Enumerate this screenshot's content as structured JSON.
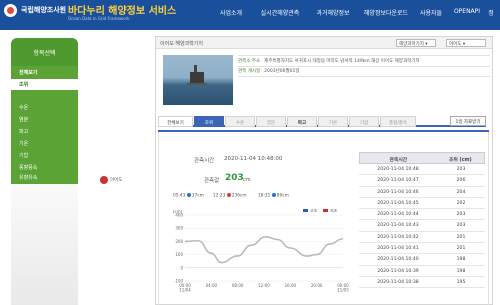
{
  "header": {
    "agency": "국립해양조사원",
    "service": "바다누리 해양정보 서비스",
    "subtitle": "Ocean Data in Grid Framework",
    "nav": [
      "사업소개",
      "실시간해양관측",
      "과거해양정보",
      "해양정보다운로드",
      "사용자들",
      "OPENAPI"
    ],
    "nav_tail": "정"
  },
  "sidebar": {
    "title": "항목선택",
    "items": [
      "전체보기",
      "조위",
      "수온",
      "염분",
      "파고",
      "기온",
      "기압",
      "풍향풍속",
      "유향유속"
    ],
    "active_index": 1,
    "legend_label": "이어도"
  },
  "panel": {
    "title": "이어도 해양과학기지",
    "select_type": "해양과학기지",
    "select_station": "이어도",
    "info": [
      {
        "key": "관측소 주소",
        "value": "제주특별자치도 서귀포시 대정읍 마라도 남서쪽 149km 해상 이어도 해양과학기지"
      },
      {
        "key": "관측 개시일",
        "value": "2003년06월01일"
      }
    ]
  },
  "tabs": {
    "items": [
      "전체보기",
      "조위",
      "수온",
      "염분",
      "파고",
      "기온",
      "기압",
      "풍향/풍속"
    ],
    "active_index": 1,
    "download_label": "1일 자료받기"
  },
  "observation": {
    "time_label": "관측시간",
    "time_value": "2020-11-04 10:48:00",
    "tide_label": "관측값",
    "tide_value": "203",
    "tide_unit": "cm",
    "tide_times": [
      {
        "time": "05:43",
        "value": "37cm",
        "color": "#2b6cd6"
      },
      {
        "time": "12:23",
        "value": "236cm",
        "color": "#d6442b"
      },
      {
        "time": "18:31",
        "value": "89cm",
        "color": "#2b6cd6"
      }
    ]
  },
  "chart_data": {
    "type": "line",
    "legend": [
      "고조",
      "저조"
    ],
    "legend_colors": [
      "#2b5fbf",
      "#c83030"
    ],
    "x_ticks": [
      "00:00\n11/04",
      "04:00",
      "08:00",
      "12:00",
      "16:00",
      "20:00",
      "00:00\n11/05"
    ],
    "y_ticks": [
      400,
      300,
      200,
      100,
      0,
      -100
    ],
    "ylabel": "(cm)",
    "ylim": [
      -100,
      400
    ],
    "series": [
      {
        "color": "#bbbbbb",
        "x": [
          0,
          2,
          4,
          5.5,
          8,
          10,
          12.3,
          14,
          16,
          18.5,
          20,
          22,
          24
        ],
        "values": [
          200,
          205,
          110,
          40,
          90,
          170,
          236,
          215,
          150,
          89,
          100,
          180,
          220
        ]
      }
    ]
  },
  "table": {
    "headers": [
      "관측시간",
      "조위 (cm)"
    ],
    "rows": [
      [
        "2020-11-04 10:48",
        "203"
      ],
      [
        "2020-11-04 10:47",
        "206"
      ],
      [
        "2020-11-04 10:46",
        "204"
      ],
      [
        "2020-11-04 10:45",
        "202"
      ],
      [
        "2020-11-04 10:44",
        "203"
      ],
      [
        "2020-11-04 10:43",
        "203"
      ],
      [
        "2020-11-04 10:42",
        "201"
      ],
      [
        "2020-11-04 10:41",
        "201"
      ],
      [
        "2020-11-04 10:40",
        "198"
      ],
      [
        "2020-11-04 10:39",
        "198"
      ],
      [
        "2020-11-04 10:38",
        "195"
      ]
    ]
  }
}
